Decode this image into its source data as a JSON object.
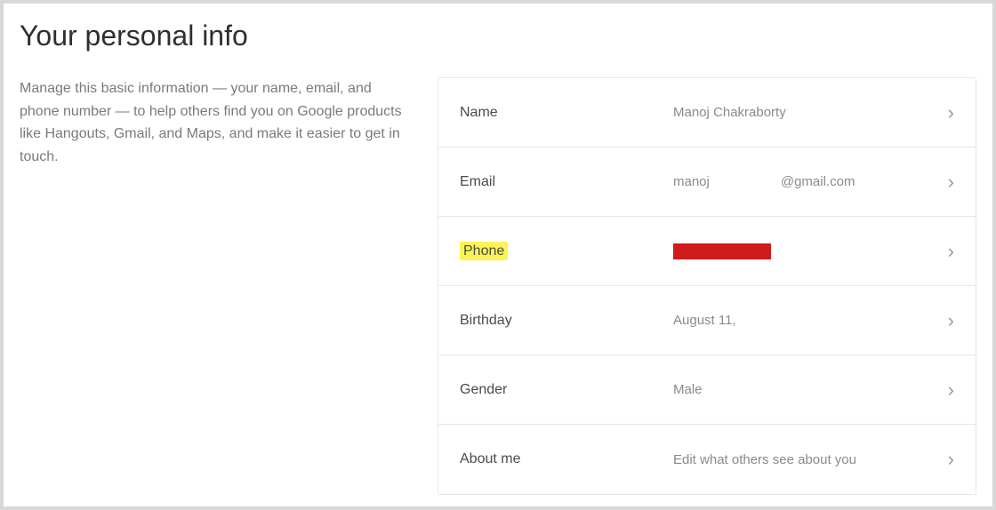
{
  "page": {
    "title": "Your personal info",
    "description": "Manage this basic information — your name, email, and phone number — to help others find you on Google products like Hangouts, Gmail, and Maps, and make it easier to get in touch."
  },
  "rows": {
    "name": {
      "label": "Name",
      "value": "Manoj Chakraborty"
    },
    "email": {
      "label": "Email",
      "value_local": "manoj",
      "value_domain": "@gmail.com"
    },
    "phone": {
      "label": "Phone",
      "redacted": true
    },
    "birthday": {
      "label": "Birthday",
      "value": "August 11,"
    },
    "gender": {
      "label": "Gender",
      "value": "Male"
    },
    "about": {
      "label": "About me",
      "value": "Edit what others see about you"
    }
  },
  "chevron": "›"
}
